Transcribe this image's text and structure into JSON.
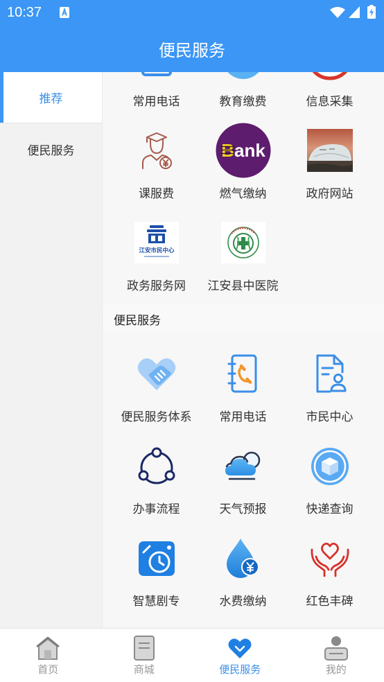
{
  "status_bar": {
    "time": "10:37",
    "icons": [
      "a-badge-icon",
      "wifi-icon",
      "signal-icon",
      "battery-charging-icon"
    ]
  },
  "header": {
    "title": "便民服务"
  },
  "sidebar": {
    "items": [
      {
        "label": "推荐",
        "active": true
      },
      {
        "label": "便民服务",
        "active": false
      }
    ]
  },
  "recommended": {
    "items": [
      {
        "label": "常用电话",
        "icon": "phone-book-icon"
      },
      {
        "label": "教育缴费",
        "icon": "education-fee-icon"
      },
      {
        "label": "信息采集",
        "icon": "info-collect-icon"
      },
      {
        "label": "课服费",
        "icon": "graduate-fee-icon"
      },
      {
        "label": "燃气缴纳",
        "icon": "bank-logo-icon",
        "logo_text_first": "B",
        "logo_text_rest": "ank"
      },
      {
        "label": "政府网站",
        "icon": "government-photo-icon"
      },
      {
        "label": "政务服务网",
        "icon": "citizen-center-logo-icon",
        "logo_text": "江安市民中心"
      },
      {
        "label": "江安县中医院",
        "icon": "hospital-logo-icon"
      }
    ]
  },
  "section": {
    "title": "便民服务",
    "items": [
      {
        "label": "便民服务体系",
        "icon": "handshake-icon"
      },
      {
        "label": "常用电话",
        "icon": "phone-book-icon"
      },
      {
        "label": "市民中心",
        "icon": "citizen-center-icon"
      },
      {
        "label": "办事流程",
        "icon": "process-flow-icon"
      },
      {
        "label": "天气预报",
        "icon": "weather-icon"
      },
      {
        "label": "快递查询",
        "icon": "delivery-box-icon"
      },
      {
        "label": "智慧剧专",
        "icon": "smart-clock-icon"
      },
      {
        "label": "水费缴纳",
        "icon": "water-fee-icon"
      },
      {
        "label": "红色丰碑",
        "icon": "red-heart-hands-icon"
      }
    ]
  },
  "bottom_nav": {
    "items": [
      {
        "label": "首页",
        "icon": "home-icon",
        "active": false
      },
      {
        "label": "商城",
        "icon": "mall-icon",
        "active": false
      },
      {
        "label": "便民服务",
        "icon": "heart-service-icon",
        "active": true
      },
      {
        "label": "我的",
        "icon": "profile-icon",
        "active": false
      }
    ]
  },
  "colors": {
    "primary": "#3b96f5",
    "active_text": "#3b8fe8",
    "label_text": "#333333",
    "nav_inactive": "#999999",
    "page_bg": "#f7f7f7"
  }
}
